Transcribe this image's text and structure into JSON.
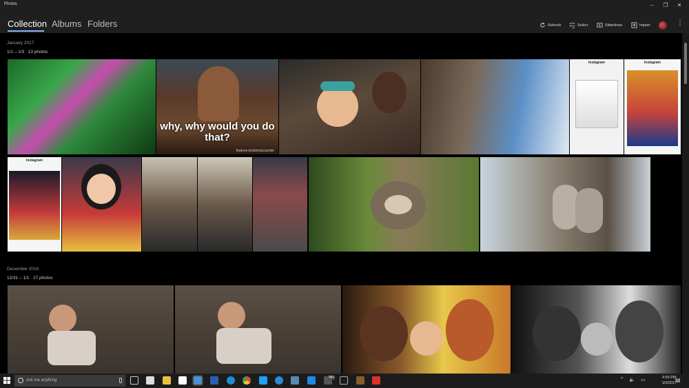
{
  "window": {
    "title": "Photos"
  },
  "nav": {
    "tabs": [
      {
        "label": "Collection"
      },
      {
        "label": "Albums"
      },
      {
        "label": "Folders"
      }
    ]
  },
  "toolbar": {
    "refresh": "Refresh",
    "select": "Select",
    "slideshow": "Slideshow",
    "import": "Import"
  },
  "groups": [
    {
      "title": "January 2017",
      "range": "1/1 – 1/3",
      "count": "13 photos"
    },
    {
      "title": "December 2016",
      "range": "12/31 – 1/1",
      "count": "27 photos"
    }
  ],
  "photos": {
    "meme_caption": "why, why would you do that?",
    "meme_watermark": "thatone.brokeinda.tumblr",
    "instagram_header": "Instagram"
  },
  "taskbar": {
    "search_placeholder": "Ask me anything",
    "time": "4:55 PM",
    "date": "1/3/2017",
    "badge": "99+"
  }
}
